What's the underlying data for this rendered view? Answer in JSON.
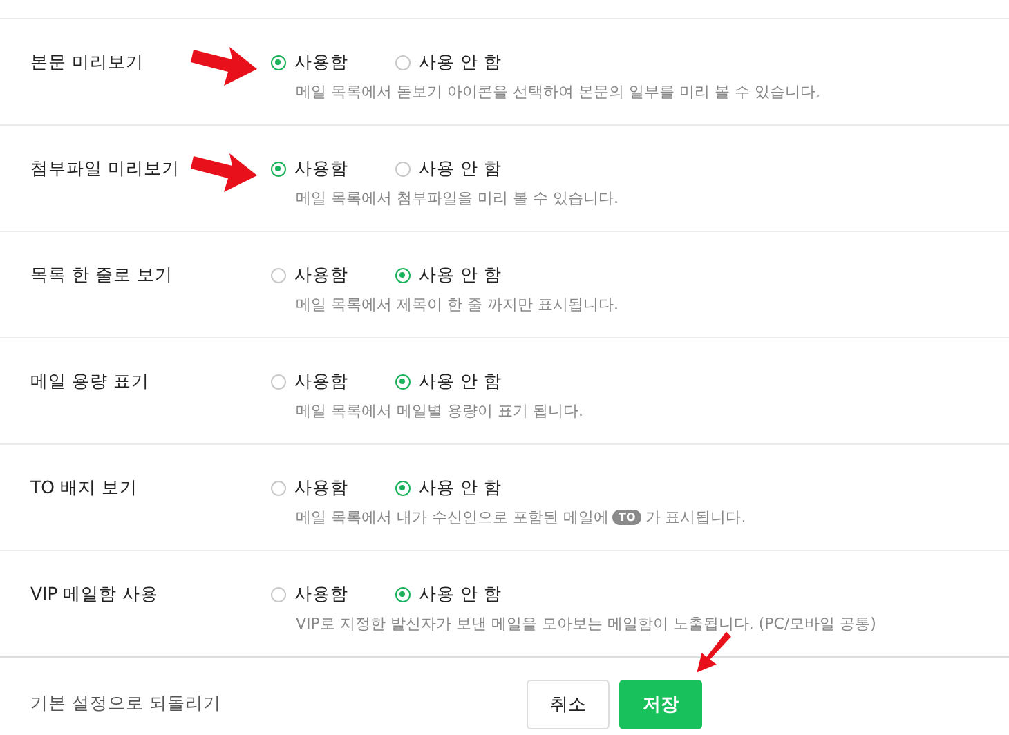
{
  "settings": [
    {
      "label": "본문 미리보기",
      "options": [
        {
          "label": "사용함",
          "selected": true
        },
        {
          "label": "사용 안 함",
          "selected": false
        }
      ],
      "description": [
        {
          "kind": "text",
          "text": "메일 목록에서 돋보기 아이콘을 선택하여 본문의 일부를 미리 볼 수 있습니다."
        }
      ]
    },
    {
      "label": "첨부파일 미리보기",
      "options": [
        {
          "label": "사용함",
          "selected": true
        },
        {
          "label": "사용 안 함",
          "selected": false
        }
      ],
      "description": [
        {
          "kind": "text",
          "text": "메일 목록에서 첨부파일을 미리 볼 수 있습니다."
        }
      ]
    },
    {
      "label": "목록 한 줄로 보기",
      "options": [
        {
          "label": "사용함",
          "selected": false
        },
        {
          "label": "사용 안 함",
          "selected": true
        }
      ],
      "description": [
        {
          "kind": "text",
          "text": "메일 목록에서 제목이 한 줄 까지만 표시됩니다."
        }
      ]
    },
    {
      "label": "메일 용량 표기",
      "options": [
        {
          "label": "사용함",
          "selected": false
        },
        {
          "label": "사용 안 함",
          "selected": true
        }
      ],
      "description": [
        {
          "kind": "text",
          "text": "메일 목록에서 메일별 용량이 표기 됩니다."
        }
      ]
    },
    {
      "label": "TO 배지 보기",
      "options": [
        {
          "label": "사용함",
          "selected": false
        },
        {
          "label": "사용 안 함",
          "selected": true
        }
      ],
      "description": [
        {
          "kind": "text",
          "text": "메일 목록에서 내가 수신인으로 포함된 메일에"
        },
        {
          "kind": "badge",
          "text": "TO"
        },
        {
          "kind": "text",
          "text": "가 표시됩니다."
        }
      ]
    },
    {
      "label": "VIP 메일함 사용",
      "options": [
        {
          "label": "사용함",
          "selected": false
        },
        {
          "label": "사용 안 함",
          "selected": true
        }
      ],
      "description": [
        {
          "kind": "text",
          "text": "VIP로 지정한 발신자가 보낸 메일을 모아보는 메일함이 노출됩니다. (PC/모바일 공통)"
        }
      ]
    }
  ],
  "footer": {
    "reset_link": "기본 설정으로 되돌리기",
    "buttons": [
      {
        "label": "취소",
        "kind": "secondary"
      },
      {
        "label": "저장",
        "kind": "primary"
      }
    ]
  }
}
